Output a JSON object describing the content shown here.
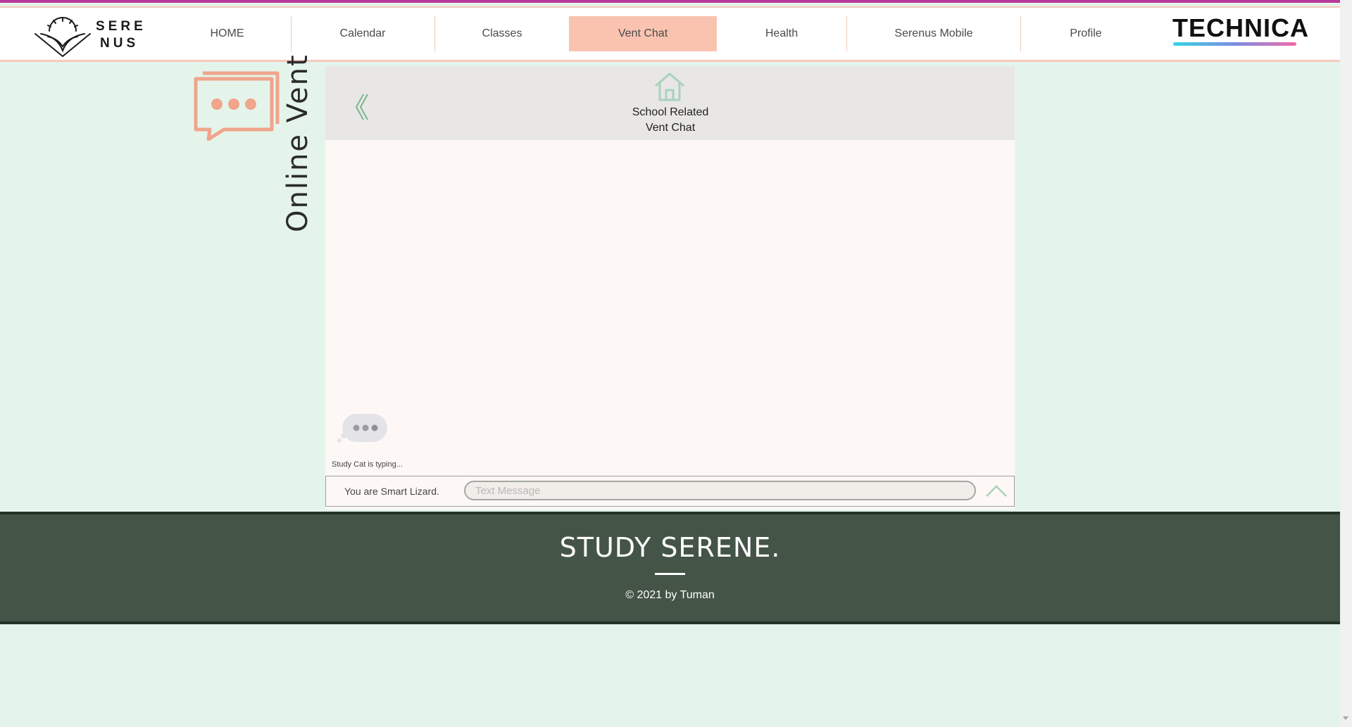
{
  "brand": {
    "line1": "SERE",
    "line2": "NUS"
  },
  "nav": {
    "items": [
      {
        "label": "HOME"
      },
      {
        "label": "Calendar"
      },
      {
        "label": "Classes"
      },
      {
        "label": "Vent Chat",
        "active": true
      },
      {
        "label": "Health"
      },
      {
        "label": "Serenus Mobile"
      },
      {
        "label": "Profile"
      }
    ]
  },
  "sponsor": {
    "label": "TECHNICA"
  },
  "page": {
    "title": "Online Vent"
  },
  "chat": {
    "room_title_line1": "School Related",
    "room_title_line2": "Vent Chat",
    "typing_status": "Study Cat is typing...",
    "identity": "You are Smart Lizard.",
    "message_placeholder": "Text Message",
    "message_value": ""
  },
  "footer": {
    "title": "STUDY SERENE.",
    "copyright": "© 2021 by Tuman"
  },
  "colors": {
    "background": "#e5f4ea",
    "accent": "#f9c3b0",
    "icon_salmon": "#f0a58c",
    "home_icon_green": "#a9d2b9",
    "footer": "#445447"
  }
}
